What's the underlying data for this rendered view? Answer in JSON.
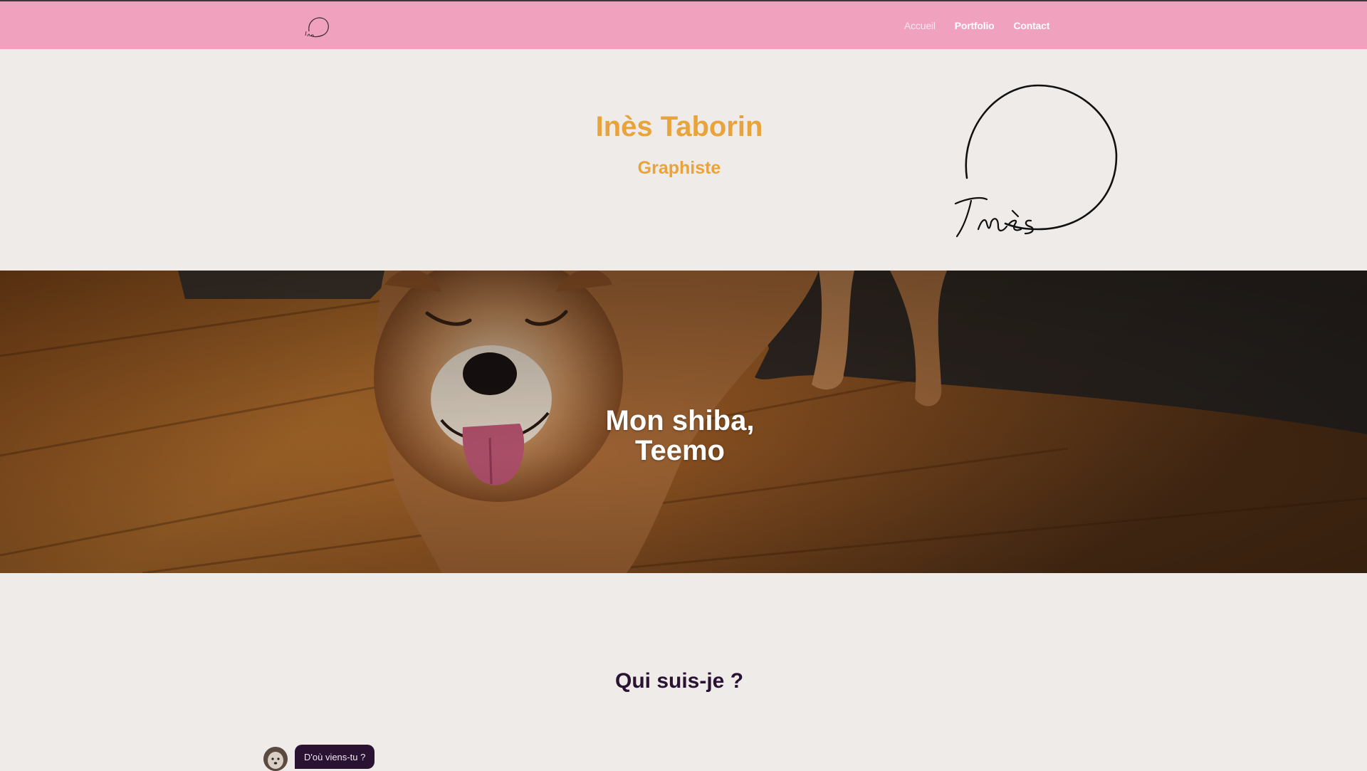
{
  "nav": {
    "logo_icon": "ines-logo-icon",
    "links": [
      {
        "label": "Accueil",
        "active": true
      },
      {
        "label": "Portfolio",
        "active": false
      },
      {
        "label": "Contact",
        "active": false
      }
    ],
    "background": "#f0a1bd"
  },
  "hero": {
    "name": "Inès Taborin",
    "subtitle": "Graphiste",
    "accent": "#e8a43b",
    "logo_icon": "ines-signature-logo",
    "logo_text": "Inès"
  },
  "banner": {
    "title_line1": "Mon shiba,",
    "title_line2": "Teemo",
    "image": "shiba-dog-photo"
  },
  "about": {
    "title": "Qui suis-je ?",
    "title_color": "#2a1233",
    "chat": {
      "avatar": "profile-avatar",
      "question": "D'où viens-tu ?"
    }
  },
  "colors": {
    "page_background": "#efebe8"
  }
}
